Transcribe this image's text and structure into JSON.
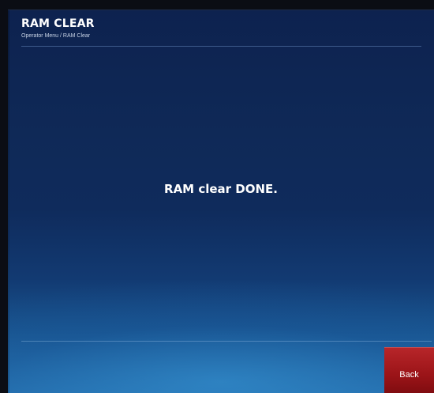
{
  "header": {
    "title": "RAM CLEAR",
    "breadcrumb": "Operator Menu / RAM Clear"
  },
  "main": {
    "message": "RAM clear DONE."
  },
  "footer": {
    "back_label": "Back"
  },
  "colors": {
    "background_top": "#0d224f",
    "background_bottom": "#2a79b6",
    "back_button": "#9b1418",
    "text": "#ffffff"
  }
}
